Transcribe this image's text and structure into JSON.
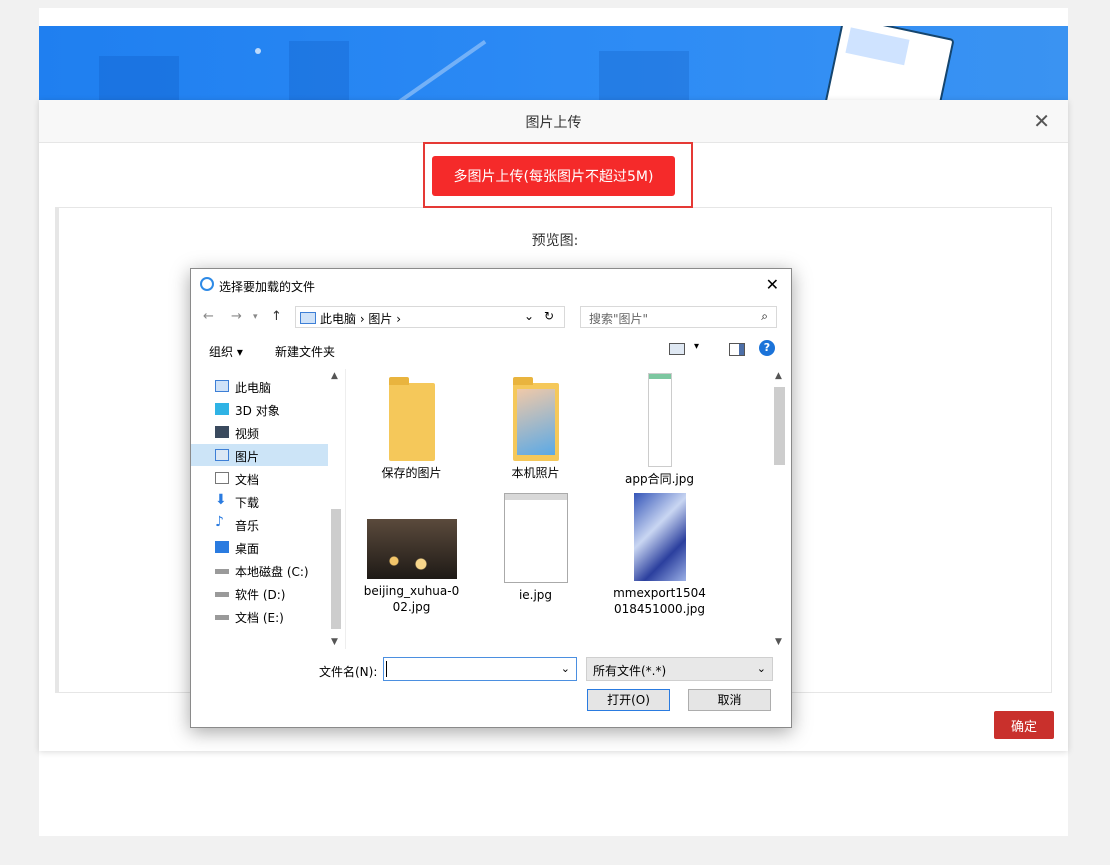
{
  "modal": {
    "title": "图片上传",
    "close_icon": "close-icon",
    "upload_button_label": "多图片上传(每张图片不超过5M)",
    "preview_label": "预览图:",
    "confirm_label": "确定",
    "colors": {
      "upload_button": "#f52a2a",
      "confirm_button": "#c9302c",
      "highlight_border": "#e53935"
    }
  },
  "dialog": {
    "title": "选择要加载的文件",
    "address": {
      "path": "此电脑 › 图片 ›"
    },
    "search_placeholder": "搜索\"图片\"",
    "toolbar": {
      "organize": "组织 ▾",
      "new_folder": "新建文件夹",
      "help": "?"
    },
    "nav_items": [
      {
        "label": "此电脑",
        "icon": "computer-icon"
      },
      {
        "label": "3D 对象",
        "icon": "cube-icon"
      },
      {
        "label": "视频",
        "icon": "video-icon"
      },
      {
        "label": "图片",
        "icon": "picture-icon",
        "selected": true
      },
      {
        "label": "文档",
        "icon": "document-icon"
      },
      {
        "label": "下载",
        "icon": "download-icon"
      },
      {
        "label": "音乐",
        "icon": "music-icon"
      },
      {
        "label": "桌面",
        "icon": "desktop-icon"
      },
      {
        "label": "本地磁盘 (C:)",
        "icon": "drive-icon"
      },
      {
        "label": "软件 (D:)",
        "icon": "drive-icon"
      },
      {
        "label": "文档 (E:)",
        "icon": "drive-icon"
      }
    ],
    "files": [
      {
        "name": "保存的图片",
        "type": "folder"
      },
      {
        "name": "本机照片",
        "type": "folder-photo"
      },
      {
        "name": "app合同.jpg",
        "type": "document-image"
      },
      {
        "name": "beijing_xuhua-0\n02.jpg",
        "type": "photo-bokeh"
      },
      {
        "name": "ie.jpg",
        "type": "screenshot-image"
      },
      {
        "name": "mmexport1504\n018451000.jpg",
        "type": "photo-blue"
      }
    ],
    "filename_label": "文件名(N):",
    "filename_value": "",
    "filetype_value": "所有文件(*.*)",
    "open_label": "打开(O)",
    "cancel_label": "取消"
  }
}
